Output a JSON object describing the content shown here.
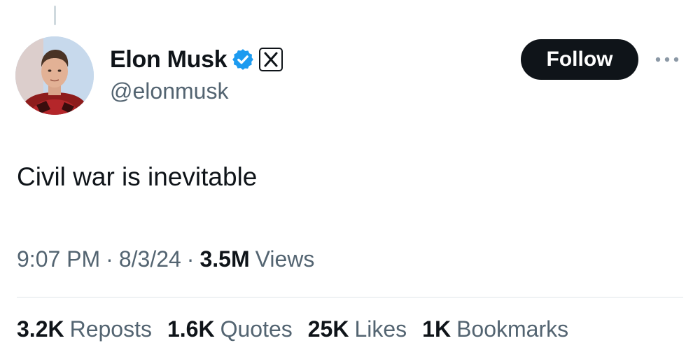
{
  "author": {
    "display_name": "Elon Musk",
    "handle": "@elonmusk"
  },
  "icons": {
    "verified": "verified-badge-icon",
    "affiliation": "x-logo-icon",
    "more": "more-horizontal-icon"
  },
  "colors": {
    "verified_blue": "#1d9bf0",
    "follow_bg": "#0f1419",
    "secondary_text": "#536471"
  },
  "follow_label": "Follow",
  "tweet_text": "Civil war is inevitable",
  "meta": {
    "time": "9:07 PM",
    "date": "8/3/24",
    "views_count": "3.5M",
    "views_label": "Views"
  },
  "stats": [
    {
      "count": "3.2K",
      "label": "Reposts"
    },
    {
      "count": "1.6K",
      "label": "Quotes"
    },
    {
      "count": "25K",
      "label": "Likes"
    },
    {
      "count": "1K",
      "label": "Bookmarks"
    }
  ]
}
